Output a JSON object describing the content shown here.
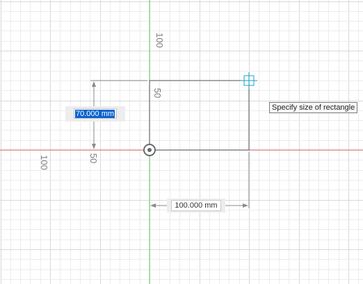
{
  "grid_labels": {
    "y_axis_top": "100",
    "x_axis_left": "100",
    "rect_side_50": "50",
    "dim_side_50": "50"
  },
  "height_dimension": {
    "value": "70.000 mm",
    "selected": true
  },
  "width_dimension": {
    "value": "100.000 mm"
  },
  "tooltip": {
    "text": "Specify size of rectangle"
  },
  "colors": {
    "x_axis": "#e26d6d",
    "y_axis": "#5fcf5f",
    "grid_minor": "#ececec",
    "grid_major": "#d8d8d8",
    "sketch": "#5a5a5a",
    "cursor": "#1aa3c8",
    "selection": "#0a64cf"
  },
  "icons": {
    "origin": "origin-point-icon",
    "cursor": "crosshair-cursor-icon"
  }
}
